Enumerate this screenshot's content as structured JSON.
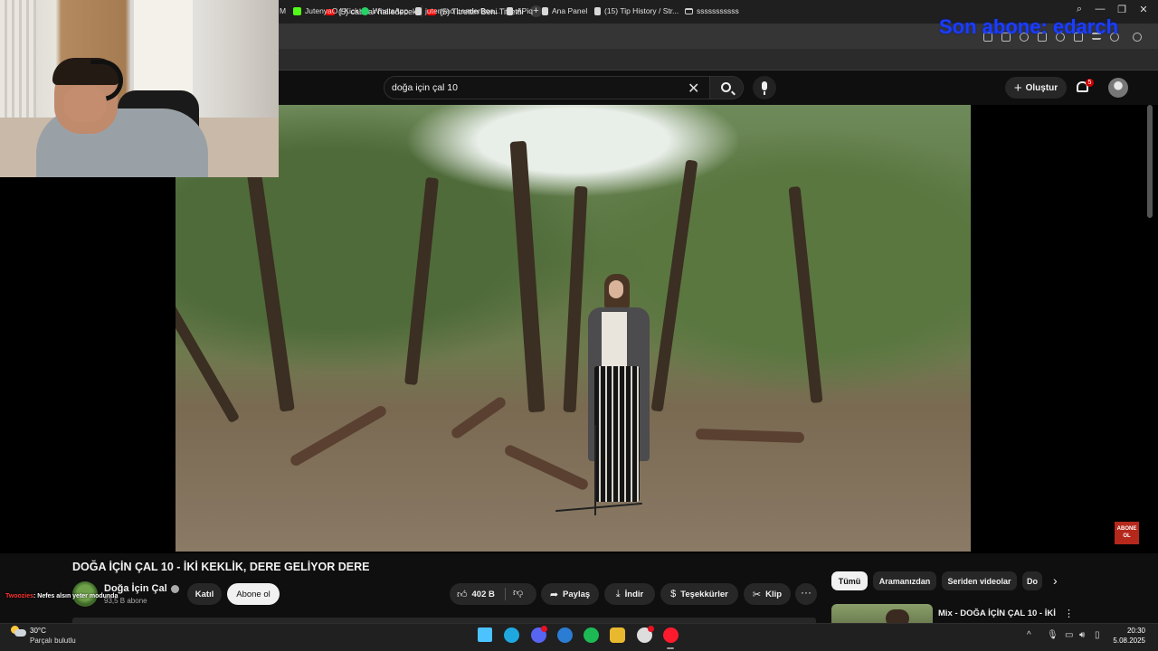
{
  "browser": {
    "tabs": [
      {
        "label": "(5) cabbar halledecekmiş"
      },
      {
        "label": "(5) Titrettin Beni Titrettin |"
      }
    ],
    "new_tab_label": "+",
    "window_controls": {
      "search": "⌕",
      "minimize": "—",
      "restore": "❐",
      "close": "✕"
    }
  },
  "stream_overlay": {
    "text": "Son abone: edarch"
  },
  "bookmarks": [
    {
      "label": "M",
      "icon": "generic"
    },
    {
      "label": "JutenyaO | Kick",
      "icon": "kick-icon"
    },
    {
      "label": "WhatsApp",
      "icon": "whatsapp-icon"
    },
    {
      "label": "jutenyao LeaderBoa...",
      "icon": "page-icon"
    },
    {
      "label": "APiq",
      "icon": "page-icon"
    },
    {
      "label": "Ana Panel",
      "icon": "page-icon"
    },
    {
      "label": "(15) Tip History / Str...",
      "icon": "page-icon"
    },
    {
      "label": "sssssssssss",
      "icon": "folder-icon"
    }
  ],
  "youtube": {
    "search": {
      "value": "doğa için çal 10"
    },
    "create_label": "Oluştur",
    "notification_count": "5",
    "video": {
      "title": "DOĞA İÇİN ÇAL 10 - İKİ KEKLİK, DERE GELİYOR DERE",
      "channel": "Doğa İçin Çal",
      "subscribers": "93,5 B abone",
      "join_label": "Katıl",
      "subscribe_label": "Abone ol",
      "likes": "402 B",
      "share_label": "Paylaş",
      "download_label": "İndir",
      "thanks_label": "Teşekkürler",
      "clip_label": "Klip",
      "more_label": "···",
      "corner_badge": "ABONE OL"
    },
    "chips": [
      {
        "label": "Tümü",
        "active": true
      },
      {
        "label": "Aramanızdan",
        "active": false
      },
      {
        "label": "Seriden videolar",
        "active": false
      },
      {
        "label": "Do",
        "active": false
      }
    ],
    "chips_next": "›",
    "related": [
      {
        "title": "Mix - DOĞA İÇİN ÇAL 10 - İKİ",
        "more": "⋮"
      }
    ]
  },
  "chat": {
    "user": "Twoozies",
    "message": ": Nefes alsın yeter modunda"
  },
  "taskbar": {
    "weather": {
      "temp": "30°C",
      "desc": "Parçalı bulutlu"
    },
    "clock": {
      "time": "20:30",
      "date": "5.08.2025"
    },
    "tray_arrow": "^",
    "icons": [
      "start-icon",
      "edge-icon",
      "discord-icon",
      "edge-alt-icon",
      "spotify-icon",
      "files-icon",
      "chrome-icon",
      "opera-icon"
    ],
    "icon_colors": [
      "#4cc2ff",
      "#1fa8e0",
      "#5865f2",
      "#2b7cd3",
      "#1db954",
      "#e8b92f",
      "#dddddd",
      "#ff1b2d"
    ]
  }
}
